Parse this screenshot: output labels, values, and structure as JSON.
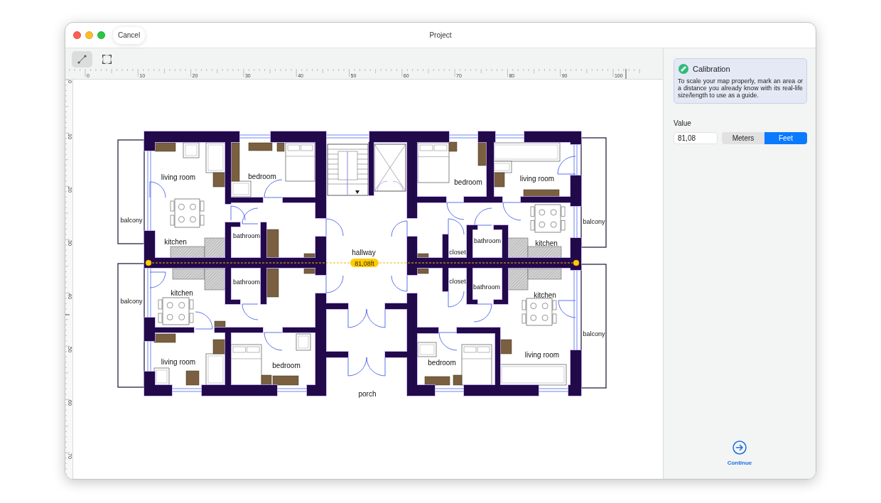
{
  "window": {
    "title": "Project",
    "cancel_button": "Cancel"
  },
  "toolbar": {
    "tools": [
      {
        "kind": "line",
        "selected": true
      },
      {
        "kind": "area",
        "selected": false
      }
    ]
  },
  "rulers": {
    "horizontal": [
      "0",
      "10",
      "20",
      "30",
      "40",
      "50",
      "60",
      "70",
      "80",
      "90",
      "100"
    ],
    "vertical": [
      "0",
      "10",
      "20",
      "30",
      "40",
      "50",
      "60",
      "70"
    ]
  },
  "floor_plan": {
    "rooms": [
      {
        "label": "living room"
      },
      {
        "label": "bedroom"
      },
      {
        "label": "balcony"
      },
      {
        "label": "bathroom"
      },
      {
        "label": "kitchen"
      },
      {
        "label": "bathroom"
      },
      {
        "label": "kitchen"
      },
      {
        "label": "balcony"
      },
      {
        "label": "living room"
      },
      {
        "label": "bedroom"
      },
      {
        "label": "hallway"
      },
      {
        "label": "porch"
      },
      {
        "label": "bedroom"
      },
      {
        "label": "living room"
      },
      {
        "label": "balcony"
      },
      {
        "label": "bathroom"
      },
      {
        "label": "closet"
      },
      {
        "label": "kitchen"
      },
      {
        "label": "closet"
      },
      {
        "label": "bathroom"
      },
      {
        "label": "kitchen"
      },
      {
        "label": "balcony"
      },
      {
        "label": "living room"
      },
      {
        "label": "bedroom"
      }
    ],
    "measurement": {
      "label": "81,08ft"
    }
  },
  "calibration": {
    "title": "Calibration",
    "description": "To scale your map properly, mark an area or a distance you already know with its real-life size/length to use as a guide.",
    "value_label": "Value",
    "value": "81,08",
    "units": [
      {
        "label": "Meters",
        "selected": false
      },
      {
        "label": "Feet",
        "selected": true
      }
    ]
  },
  "continue_button": {
    "label": "Continue"
  }
}
